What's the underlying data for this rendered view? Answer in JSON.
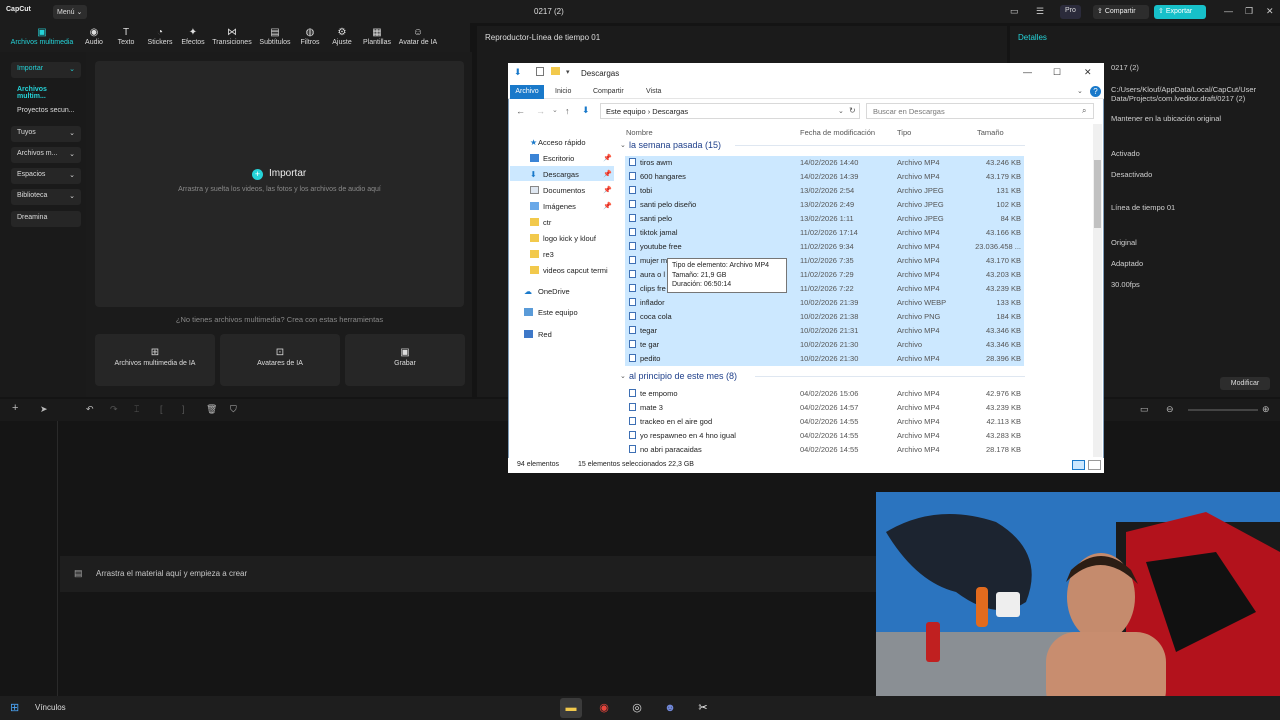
{
  "app": {
    "name": "CapCut",
    "menu": "Menú",
    "project_title": "0217 (2)",
    "pro": "Pro",
    "share": "Compartir",
    "export": "Exportar"
  },
  "toolbar": [
    "Archivos multimedia",
    "Audio",
    "Texto",
    "Stickers",
    "Efectos",
    "Transiciones",
    "Subtítulos",
    "Filtros",
    "Ajuste",
    "Plantillas",
    "Avatar de IA"
  ],
  "leftnav": [
    "Importar",
    "Archivos multim...",
    "Proyectos secun...",
    "Tuyos",
    "Archivos m...",
    "Espacios",
    "Biblioteca",
    "Dreamina"
  ],
  "media": {
    "import_label": "Importar",
    "import_hint": "Arrastra y suelta los videos, las fotos y los archivos de audio aquí",
    "no_media": "¿No tienes archivos multimedia? Crea con estas herramientas",
    "tools": [
      "Archivos multimedia de IA",
      "Avatares de IA",
      "Grabar"
    ]
  },
  "player": {
    "title": "Reproductor-Línea de tiempo 01"
  },
  "details": {
    "title": "Detalles",
    "values": [
      "0217 (2)",
      "C:/Users/Klouf/AppData/Local/CapCut/User Data/Projects/com.lveditor.draft/0217 (2)",
      "Mantener en la ubicación original",
      "Activado",
      "Desactivado",
      "Línea de tiempo 01",
      "Original",
      "Adaptado",
      "30.00fps"
    ],
    "modify": "Modificar"
  },
  "timeline": {
    "drop_text": "Arrastra el material aquí y empieza a crear"
  },
  "taskbar": {
    "label": "Vínculos"
  },
  "explorer": {
    "title": "Descargas",
    "tabs": [
      "Archivo",
      "Inicio",
      "Compartir",
      "Vista"
    ],
    "address": [
      "Este equipo",
      "Descargas"
    ],
    "search_placeholder": "Buscar en Descargas",
    "sidebar": [
      "Acceso rápido",
      "Escritorio",
      "Descargas",
      "Documentos",
      "Imágenes",
      "ctr",
      "logo kick y klouf",
      "re3",
      "videos capcut termi",
      "OneDrive",
      "Este equipo",
      "Red"
    ],
    "columns": [
      "Nombre",
      "Fecha de modificación",
      "Tipo",
      "Tamaño"
    ],
    "groups": [
      "la semana pasada (15)",
      "al principio de este mes (8)"
    ],
    "files_last_week": [
      [
        "tiros awm",
        "14/02/2026 14:40",
        "Archivo MP4",
        "43.246 KB"
      ],
      [
        "600 hangares",
        "14/02/2026 14:39",
        "Archivo MP4",
        "43.179 KB"
      ],
      [
        "tobi",
        "13/02/2026 2:54",
        "Archivo JPEG",
        "131 KB"
      ],
      [
        "santi pelo diseño",
        "13/02/2026 2:49",
        "Archivo JPEG",
        "102 KB"
      ],
      [
        "santi pelo",
        "13/02/2026 1:11",
        "Archivo JPEG",
        "84 KB"
      ],
      [
        "tiktok jamal",
        "11/02/2026 17:14",
        "Archivo MP4",
        "43.166 KB"
      ],
      [
        "youtube free",
        "11/02/2026 9:34",
        "Archivo MP4",
        "23.036.458 ..."
      ],
      [
        "mujer m",
        "11/02/2026 7:35",
        "Archivo MP4",
        "43.170 KB"
      ],
      [
        "aura o l",
        "11/02/2026 7:29",
        "Archivo MP4",
        "43.203 KB"
      ],
      [
        "clips fre",
        "11/02/2026 7:22",
        "Archivo MP4",
        "43.239 KB"
      ],
      [
        "inflador",
        "10/02/2026 21:39",
        "Archivo WEBP",
        "133 KB"
      ],
      [
        "coca cola",
        "10/02/2026 21:38",
        "Archivo PNG",
        "184 KB"
      ],
      [
        "tegar",
        "10/02/2026 21:31",
        "Archivo MP4",
        "43.346 KB"
      ],
      [
        "te gar",
        "10/02/2026 21:30",
        "Archivo",
        "43.346 KB"
      ],
      [
        "pedito",
        "10/02/2026 21:30",
        "Archivo MP4",
        "28.396 KB"
      ]
    ],
    "files_this_month": [
      [
        "te empomo",
        "04/02/2026 15:06",
        "Archivo MP4",
        "42.976 KB"
      ],
      [
        "mate 3",
        "04/02/2026 14:57",
        "Archivo MP4",
        "43.239 KB"
      ],
      [
        "trackeo en el aire god",
        "04/02/2026 14:55",
        "Archivo MP4",
        "42.113 KB"
      ],
      [
        "yo respawneo en 4 hno igual",
        "04/02/2026 14:55",
        "Archivo MP4",
        "43.283 KB"
      ],
      [
        "no abri paracaidas",
        "04/02/2026 14:55",
        "Archivo MP4",
        "28.178 KB"
      ]
    ],
    "tooltip": [
      "Tipo de elemento: Archivo MP4",
      "Tamaño: 21,9 GB",
      "Duración: 06:50:14"
    ],
    "status": [
      "94 elementos",
      "15 elementos seleccionados  22,3 GB"
    ]
  }
}
